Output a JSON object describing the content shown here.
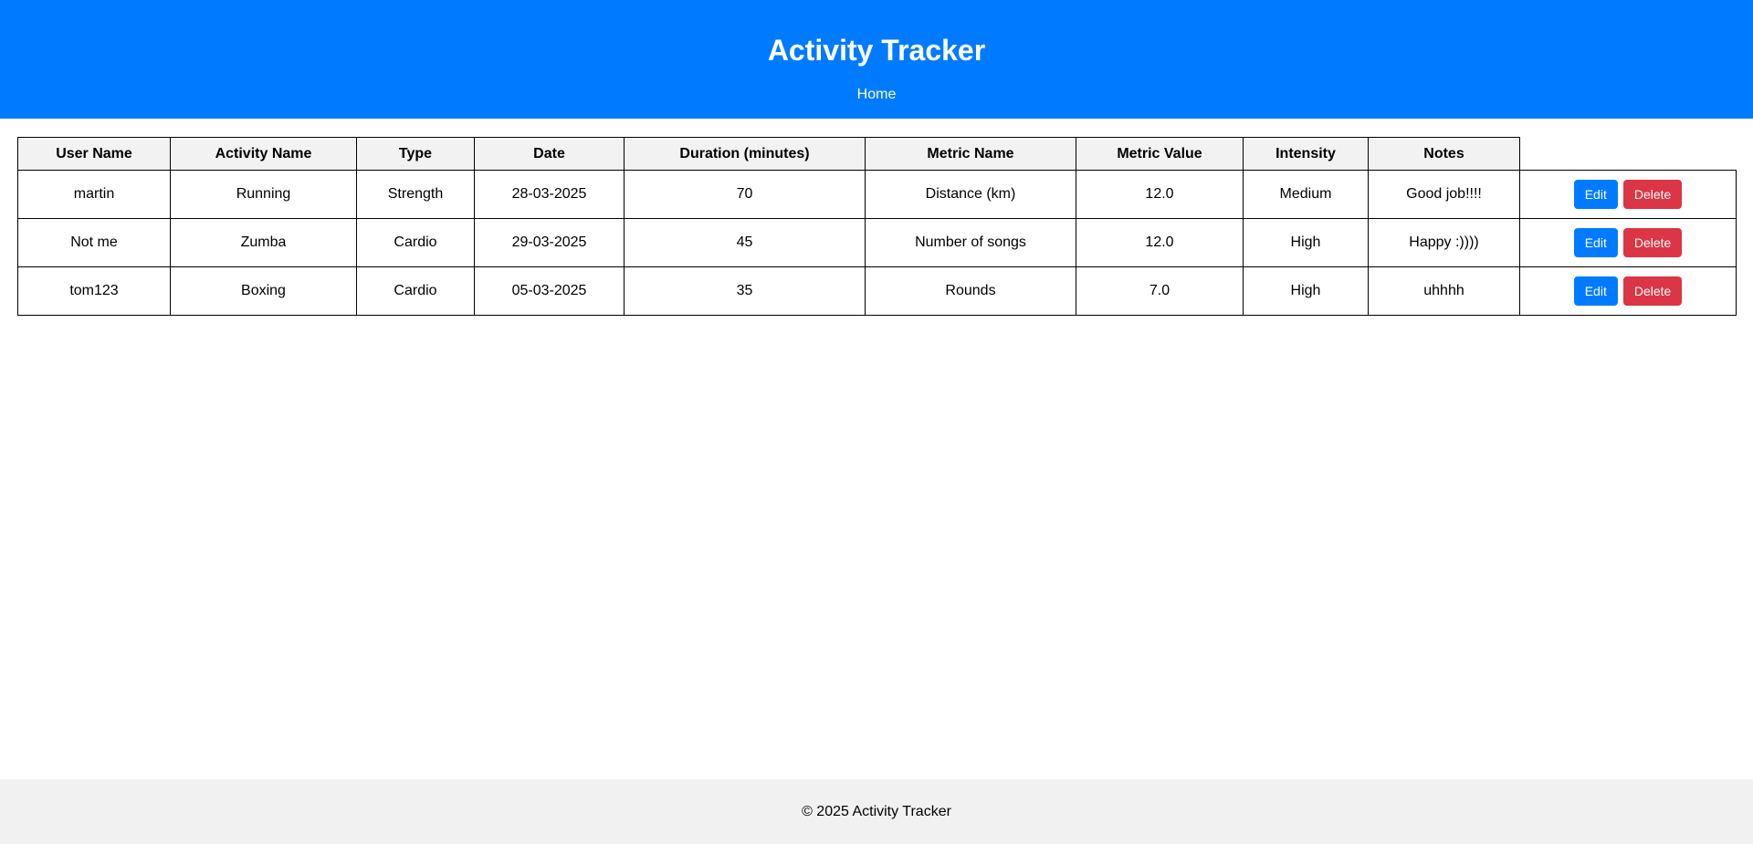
{
  "header": {
    "title": "Activity Tracker",
    "nav_home": "Home"
  },
  "table": {
    "columns": [
      "User Name",
      "Activity Name",
      "Type",
      "Date",
      "Duration (minutes)",
      "Metric Name",
      "Metric Value",
      "Intensity",
      "Notes"
    ],
    "rows": [
      [
        "martin",
        "Running",
        "Strength",
        "28-03-2025",
        "70",
        "Distance (km)",
        "12.0",
        "Medium",
        "Good job!!!!"
      ],
      [
        "Not me",
        "Zumba",
        "Cardio",
        "29-03-2025",
        "45",
        "Number of songs",
        "12.0",
        "High",
        "Happy :))))"
      ],
      [
        "tom123",
        "Boxing",
        "Cardio",
        "05-03-2025",
        "35",
        "Rounds",
        "7.0",
        "High",
        "uhhhh"
      ]
    ],
    "edit_label": "Edit",
    "delete_label": "Delete"
  },
  "footer": {
    "text": "© 2025 Activity Tracker"
  },
  "colors": {
    "primary": "#007bff",
    "danger": "#dc3545",
    "header_bg": "#f2f2f2",
    "footer_bg": "#f1f1f1"
  }
}
